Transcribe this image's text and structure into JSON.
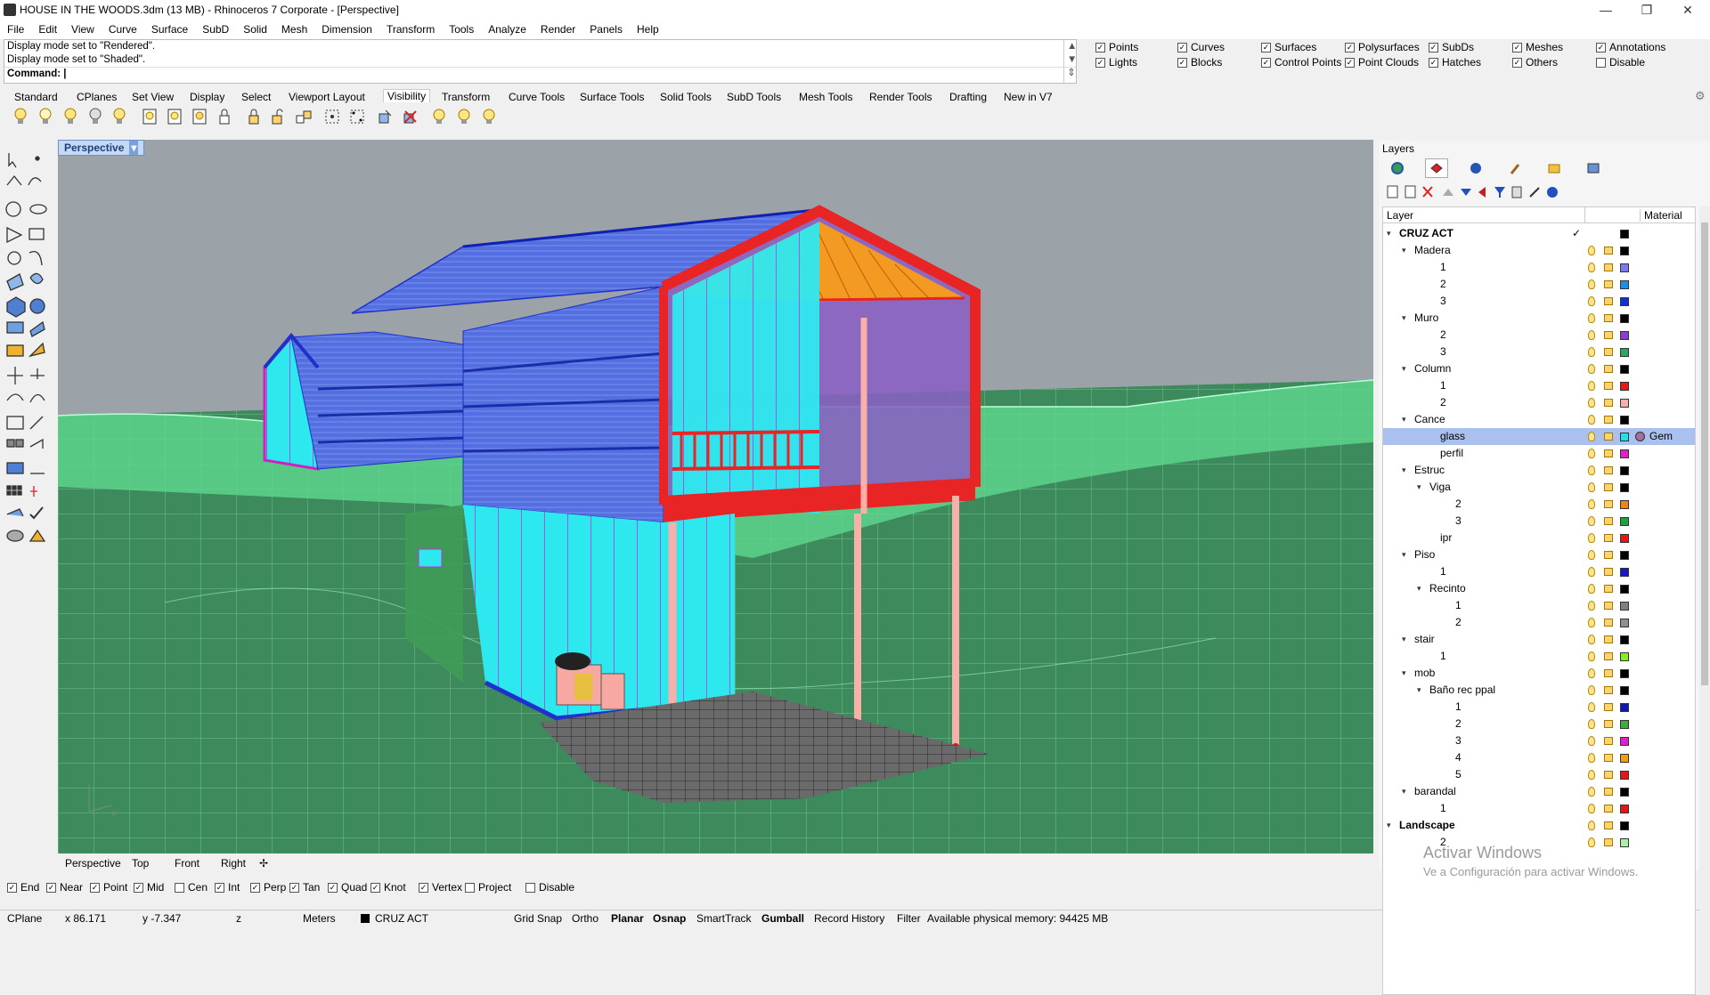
{
  "window": {
    "title": "HOUSE IN THE WOODS.3dm (13 MB) - Rhinoceros 7 Corporate - [Perspective]",
    "minimize": "—",
    "maximize": "❐",
    "close": "✕"
  },
  "menu": [
    "File",
    "Edit",
    "View",
    "Curve",
    "Surface",
    "SubD",
    "Solid",
    "Mesh",
    "Dimension",
    "Transform",
    "Tools",
    "Analyze",
    "Render",
    "Panels",
    "Help"
  ],
  "command": {
    "history1": "Display mode set to \"Rendered\".",
    "history2": "Display mode set to \"Shaded\".",
    "prompt": "Command:"
  },
  "filters": [
    {
      "label": "Points",
      "checked": true
    },
    {
      "label": "Curves",
      "checked": true
    },
    {
      "label": "Surfaces",
      "checked": true
    },
    {
      "label": "Polysurfaces",
      "checked": true
    },
    {
      "label": "SubDs",
      "checked": true
    },
    {
      "label": "Meshes",
      "checked": true
    },
    {
      "label": "Annotations",
      "checked": true
    },
    {
      "label": "Lights",
      "checked": true
    },
    {
      "label": "Blocks",
      "checked": true
    },
    {
      "label": "Control Points",
      "checked": true
    },
    {
      "label": "Point Clouds",
      "checked": true
    },
    {
      "label": "Hatches",
      "checked": true
    },
    {
      "label": "Others",
      "checked": true
    },
    {
      "label": "Disable",
      "checked": false
    }
  ],
  "toolbar_tabs": [
    "Standard",
    "CPlanes",
    "Set View",
    "Display",
    "Select",
    "Viewport Layout",
    "Visibility",
    "Transform",
    "Curve Tools",
    "Surface Tools",
    "Solid Tools",
    "SubD Tools",
    "Mesh Tools",
    "Render Tools",
    "Drafting",
    "New in V7"
  ],
  "active_tab": "Visibility",
  "viewport": {
    "label": "Perspective",
    "dropdown": "▾"
  },
  "viewport_tabs": [
    "Perspective",
    "Top",
    "Front",
    "Right",
    "✢"
  ],
  "osnaps": [
    {
      "label": "End",
      "checked": true
    },
    {
      "label": "Near",
      "checked": true
    },
    {
      "label": "Point",
      "checked": true
    },
    {
      "label": "Mid",
      "checked": true
    },
    {
      "label": "Cen",
      "checked": false
    },
    {
      "label": "Int",
      "checked": true
    },
    {
      "label": "Perp",
      "checked": true
    },
    {
      "label": "Tan",
      "checked": true
    },
    {
      "label": "Quad",
      "checked": true
    },
    {
      "label": "Knot",
      "checked": true
    },
    {
      "label": "Vertex",
      "checked": true
    },
    {
      "label": "Project",
      "checked": false
    },
    {
      "label": "Disable",
      "checked": false
    }
  ],
  "status": {
    "cplane": "CPlane",
    "x": "x 86.171",
    "y": "y -7.347",
    "z": "z",
    "units": "Meters",
    "layer": "CRUZ ACT",
    "grid_snap": "Grid Snap",
    "ortho": "Ortho",
    "planar": "Planar",
    "osnap": "Osnap",
    "smarttrack": "SmartTrack",
    "gumball": "Gumball",
    "record_history": "Record History",
    "filter": "Filter",
    "memory": "Available physical memory: 94425 MB"
  },
  "layers": {
    "title": "Layers",
    "col_layer": "Layer",
    "col_material": "Material",
    "rows": [
      {
        "name": "CRUZ ACT",
        "depth": 0,
        "expanded": true,
        "color": "#000000",
        "current": "✓"
      },
      {
        "name": "Madera",
        "depth": 1,
        "expanded": true,
        "color": "#000000"
      },
      {
        "name": "1",
        "depth": 2,
        "color": "#7a7af0"
      },
      {
        "name": "2",
        "depth": 2,
        "color": "#1e8fe8"
      },
      {
        "name": "3",
        "depth": 2,
        "color": "#1030d0"
      },
      {
        "name": "Muro",
        "depth": 1,
        "expanded": true,
        "color": "#000000"
      },
      {
        "name": "2",
        "depth": 2,
        "color": "#8a40c8"
      },
      {
        "name": "3",
        "depth": 2,
        "color": "#2aa860"
      },
      {
        "name": "Column",
        "depth": 1,
        "expanded": true,
        "color": "#000000"
      },
      {
        "name": "1",
        "depth": 2,
        "color": "#e81818"
      },
      {
        "name": "2",
        "depth": 2,
        "color": "#f8b0a8"
      },
      {
        "name": "Cance",
        "depth": 1,
        "expanded": true,
        "color": "#000000"
      },
      {
        "name": "glass",
        "depth": 2,
        "color": "#20e0e8",
        "selected": true,
        "material": "Gem"
      },
      {
        "name": "perfil",
        "depth": 2,
        "color": "#e020c8"
      },
      {
        "name": "Estruc",
        "depth": 1,
        "expanded": true,
        "color": "#000000"
      },
      {
        "name": "Viga",
        "depth": 2,
        "expanded": true,
        "color": "#000000"
      },
      {
        "name": "2",
        "depth": 3,
        "color": "#f08418"
      },
      {
        "name": "3",
        "depth": 3,
        "color": "#20a040"
      },
      {
        "name": "ipr",
        "depth": 2,
        "color": "#e01818"
      },
      {
        "name": "Piso",
        "depth": 1,
        "expanded": true,
        "color": "#000000"
      },
      {
        "name": "1",
        "depth": 2,
        "color": "#1818c8"
      },
      {
        "name": "Recinto",
        "depth": 2,
        "expanded": true,
        "color": "#000000"
      },
      {
        "name": "1",
        "depth": 3,
        "color": "#808080"
      },
      {
        "name": "2",
        "depth": 3,
        "color": "#909090"
      },
      {
        "name": "stair",
        "depth": 1,
        "expanded": true,
        "color": "#000000"
      },
      {
        "name": "1",
        "depth": 2,
        "color": "#80f020"
      },
      {
        "name": "mob",
        "depth": 1,
        "expanded": true,
        "color": "#000000"
      },
      {
        "name": "Baño rec ppal",
        "depth": 2,
        "expanded": true,
        "color": "#000000"
      },
      {
        "name": "1",
        "depth": 3,
        "color": "#1018b0"
      },
      {
        "name": "2",
        "depth": 3,
        "color": "#38b038"
      },
      {
        "name": "3",
        "depth": 3,
        "color": "#e020c8"
      },
      {
        "name": "4",
        "depth": 3,
        "color": "#f0a010"
      },
      {
        "name": "5",
        "depth": 3,
        "color": "#e01818"
      },
      {
        "name": "barandal",
        "depth": 1,
        "expanded": true,
        "color": "#000000"
      },
      {
        "name": "1",
        "depth": 2,
        "color": "#e01818"
      },
      {
        "name": "Landscape",
        "depth": 0,
        "expanded": true,
        "color": "#000000"
      },
      {
        "name": "2",
        "depth": 2,
        "color": "#a8f0a8"
      }
    ]
  },
  "watermark": {
    "line1": "Activar Windows",
    "line2": "Ve a Configuración para activar Windows."
  }
}
